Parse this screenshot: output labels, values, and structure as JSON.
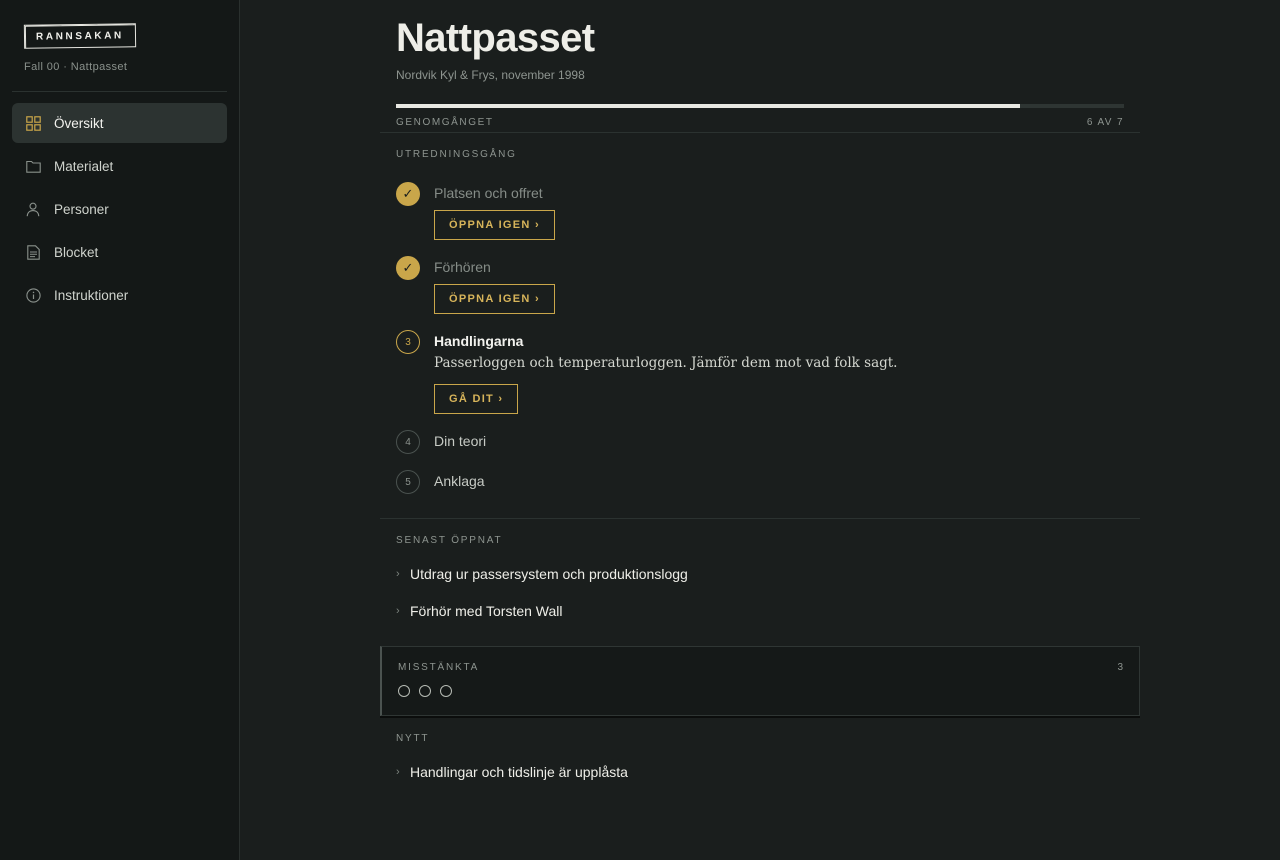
{
  "sidebar": {
    "logo": "RANNSAKAN",
    "case_subtitle": "Fall 00 · Nattpasset",
    "items": [
      {
        "label": "Översikt",
        "icon": "grid-icon",
        "active": true
      },
      {
        "label": "Materialet",
        "icon": "folder-icon",
        "active": false
      },
      {
        "label": "Personer",
        "icon": "person-icon",
        "active": false
      },
      {
        "label": "Blocket",
        "icon": "notepad-icon",
        "active": false
      },
      {
        "label": "Instruktioner",
        "icon": "info-icon",
        "active": false
      }
    ]
  },
  "header": {
    "title": "Nattpasset",
    "subtitle": "Nordvik Kyl & Frys, november 1998"
  },
  "progress": {
    "label": "GENOMGÅNGET",
    "count_text": "6 AV 7",
    "done": 6,
    "total": 7
  },
  "investigation": {
    "label": "UTREDNINGSGÅNG",
    "steps": [
      {
        "marker": "✓",
        "title": "Platsen och offret",
        "state": "done",
        "button": "ÖPPNA IGEN ›"
      },
      {
        "marker": "✓",
        "title": "Förhören",
        "state": "done",
        "button": "ÖPPNA IGEN ›"
      },
      {
        "marker": "3",
        "title": "Handlingarna",
        "state": "current",
        "description": "Passerloggen och temperaturloggen. Jämför dem mot vad folk sagt.",
        "button": "GÅ DIT ›"
      },
      {
        "marker": "4",
        "title": "Din teori",
        "state": "todo"
      },
      {
        "marker": "5",
        "title": "Anklaga",
        "state": "todo"
      }
    ]
  },
  "recent": {
    "label": "SENAST ÖPPNAT",
    "items": [
      "Utdrag ur passersystem och produktionslogg",
      "Förhör med Torsten Wall"
    ]
  },
  "suspects": {
    "label": "MISSTÄNKTA",
    "count": "3"
  },
  "news": {
    "label": "NYTT",
    "items": [
      "Handlingar och tidslinje är upplåsta"
    ]
  },
  "colors": {
    "accent": "#c9a64a",
    "background": "#1a1e1d",
    "sidebar": "#141817"
  }
}
